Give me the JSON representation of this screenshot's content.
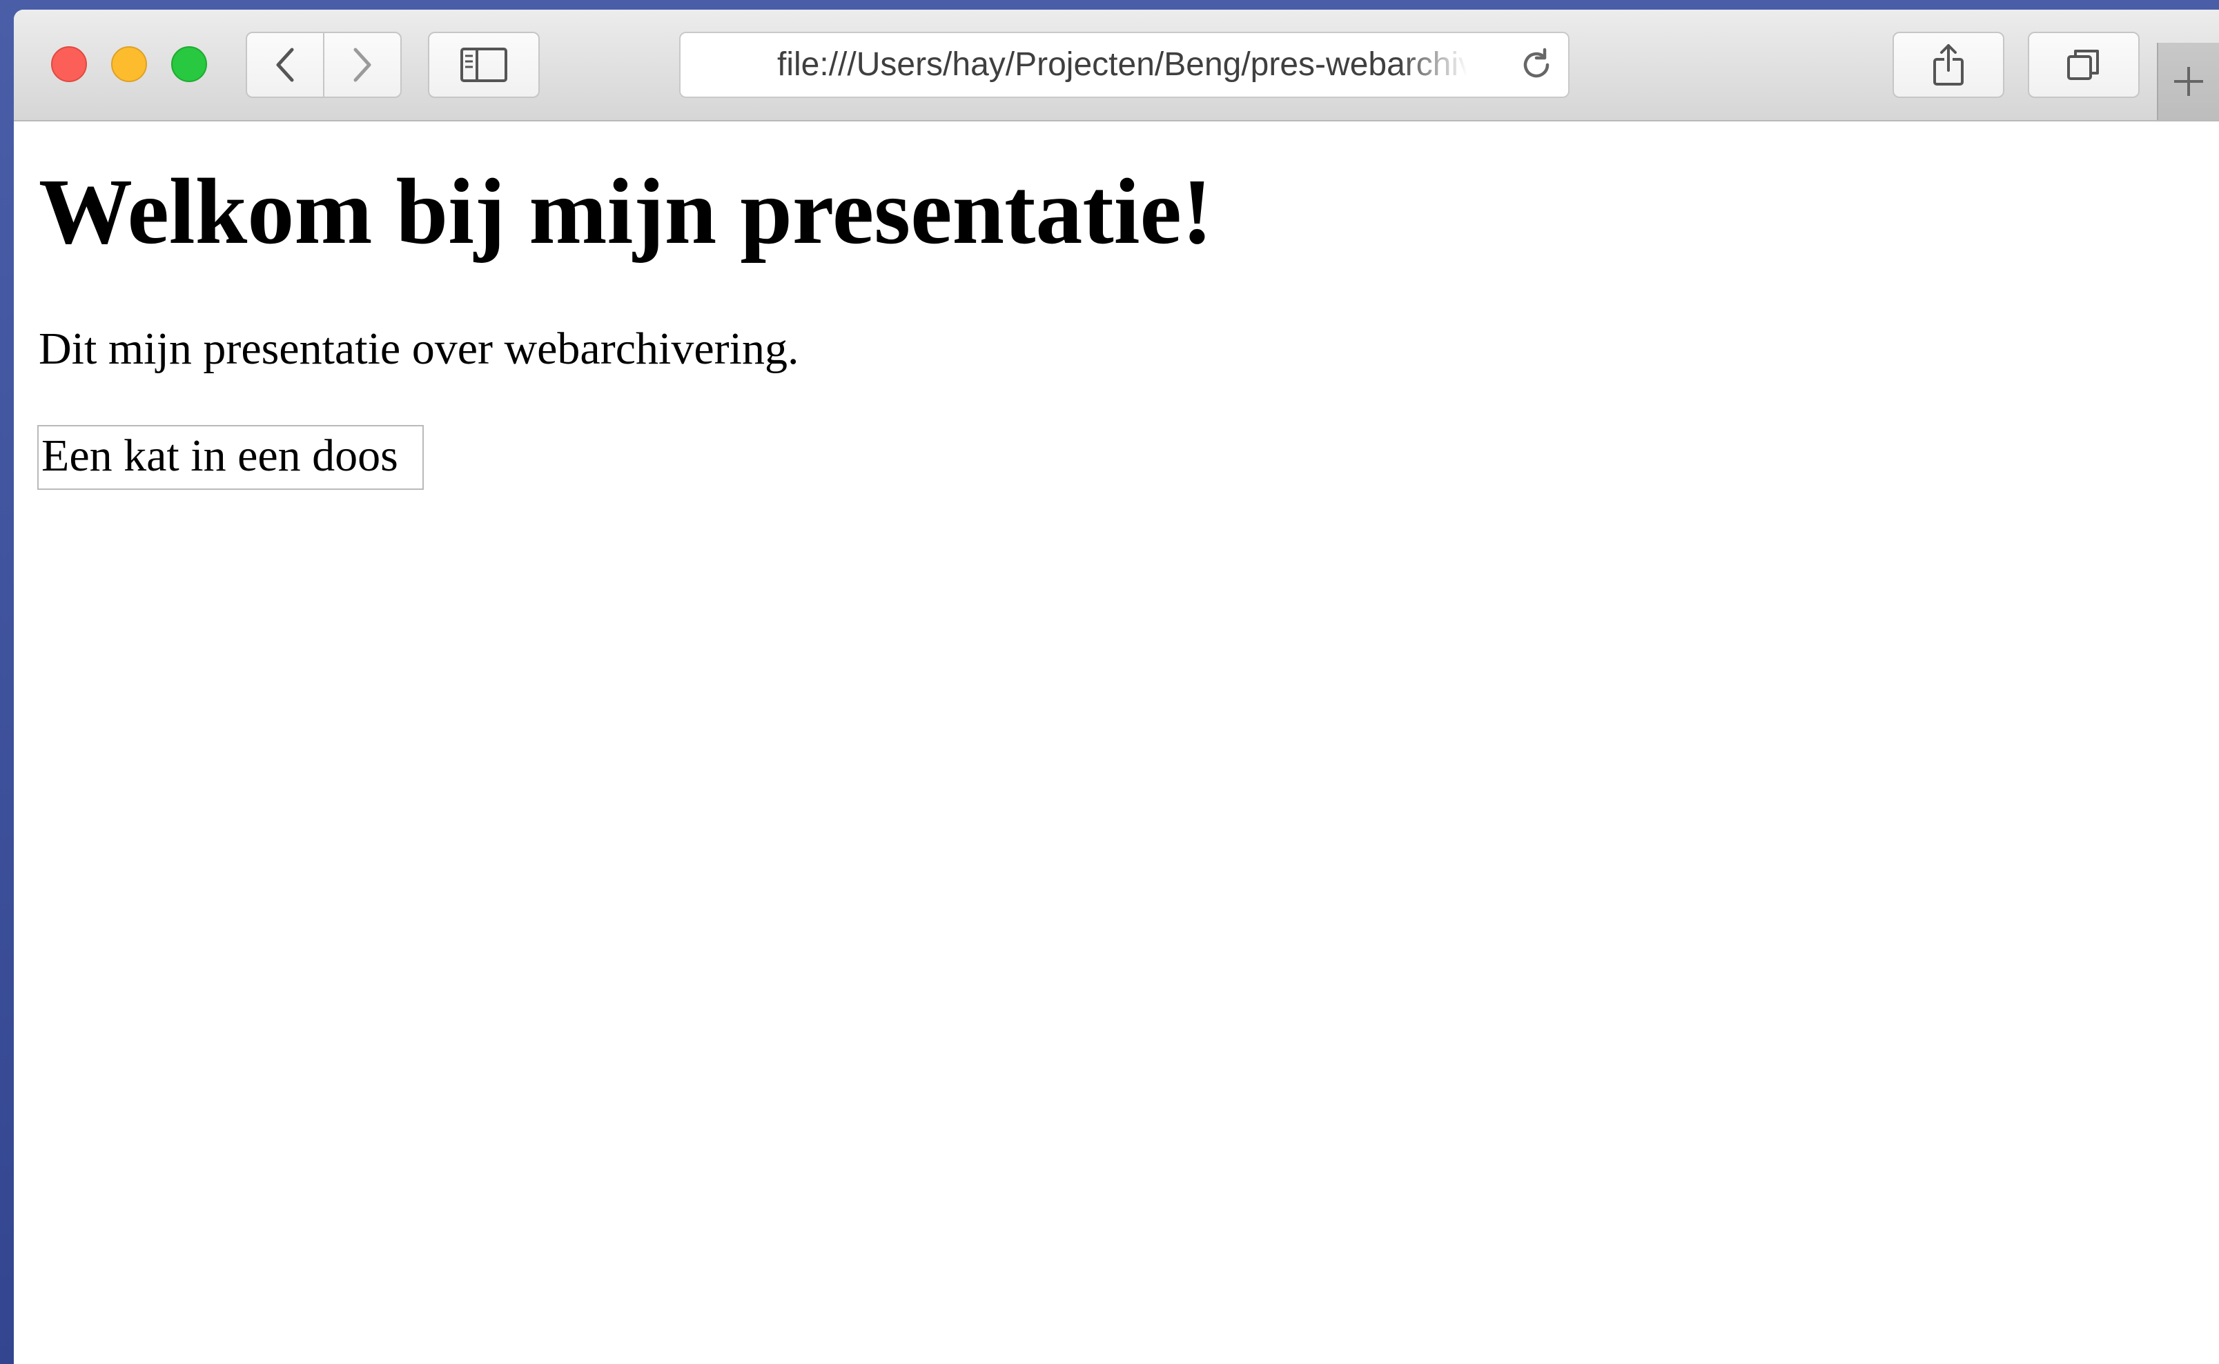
{
  "browser": {
    "window_controls": [
      "close",
      "minimize",
      "zoom"
    ],
    "address_bar": {
      "url": "file:///Users/hay/Projecten/Beng/pres-webarchivering/index.html"
    },
    "icons": {
      "back": "chevron-left-icon",
      "forward": "chevron-right-icon",
      "sidebar": "sidebar-icon",
      "reload": "reload-icon",
      "share": "share-icon",
      "tabs": "tabs-overview-icon",
      "new_tab": "plus-icon"
    },
    "colors": {
      "close": "#fc5f57",
      "minimize": "#fdbc2e",
      "zoom": "#28c840"
    }
  },
  "page": {
    "heading": "Welkom bij mijn presentatie!",
    "paragraph": "Dit mijn presentatie over webarchivering.",
    "image_alt": "Een kat in een doos"
  }
}
